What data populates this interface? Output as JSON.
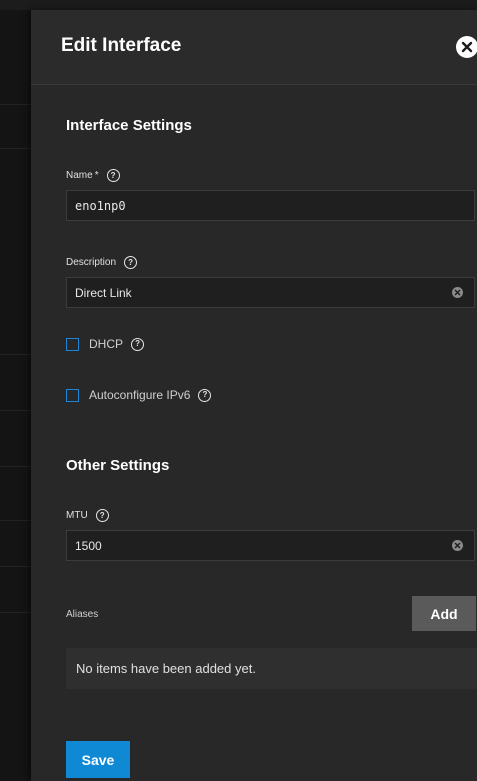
{
  "panel": {
    "title": "Edit Interface"
  },
  "interface_settings": {
    "title": "Interface Settings",
    "name": {
      "label": "Name",
      "required_marker": "*",
      "value": "eno1np0"
    },
    "description": {
      "label": "Description",
      "value": "Direct Link"
    },
    "dhcp": {
      "label": "DHCP",
      "checked": false
    },
    "ipv6": {
      "label": "Autoconfigure IPv6",
      "checked": false
    }
  },
  "other_settings": {
    "title": "Other Settings",
    "mtu": {
      "label": "MTU",
      "value": "1500"
    }
  },
  "aliases": {
    "label": "Aliases",
    "add_label": "Add",
    "empty_text": "No items have been added yet."
  },
  "actions": {
    "save_label": "Save"
  },
  "colors": {
    "accent": "#0f89d3",
    "checkbox_border": "#1e84d6",
    "panel_bg": "#282828",
    "input_bg": "#1f1f1f"
  },
  "icons": {
    "close": "close-icon",
    "help": "help-circle-icon",
    "clear": "clear-circle-icon"
  }
}
